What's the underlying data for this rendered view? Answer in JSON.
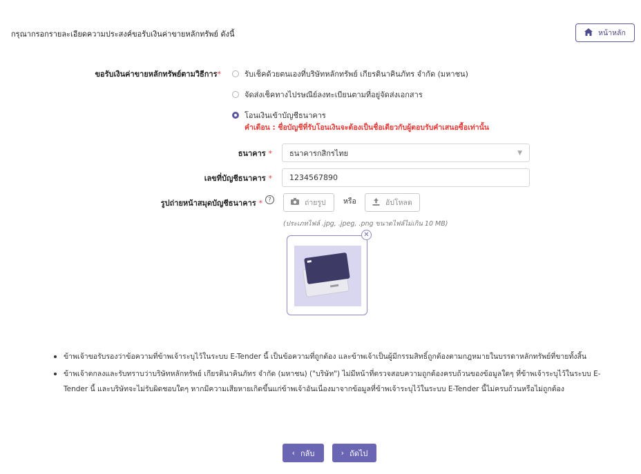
{
  "header": {
    "instruction": "กรุณากรอกรายละเอียดความประสงค์ขอรับเงินค่าขายหลักทรัพย์ ดังนี้",
    "home_label": "หน้าหลัก"
  },
  "form": {
    "method_label": "ขอรับเงินค่าขายหลักทรัพย์ตามวิธีการ",
    "required_mark": "*",
    "options": [
      {
        "label": "รับเช็คด้วยตนเองที่บริษัทหลักทรัพย์ เกียรตินาคินภัทร จำกัด (มหาชน)",
        "checked": false
      },
      {
        "label": "จัดส่งเช็คทางไปรษณีย์ลงทะเบียนตามที่อยู่จัดส่งเอกสาร",
        "checked": false
      },
      {
        "label": "โอนเงินเข้าบัญชีธนาคาร",
        "checked": true
      }
    ],
    "warning": "คำเตือน : ชื่อบัญชีที่รับโอนเงินจะต้องเป็นชื่อเดียวกับผู้ตอบรับคำเสนอซื้อเท่านั้น",
    "bank_label": "ธนาคาร",
    "bank_value": "ธนาคารกสิกรไทย",
    "account_label": "เลขที่บัญชีธนาคาร",
    "account_value": "1234567890",
    "photo_label": "รูปถ่ายหน้าสมุดบัญชีธนาคาร",
    "camera_label": "ถ่ายรูป",
    "or_label": "หรือ",
    "upload_label": "อัปโหลด",
    "file_hint": "(ประเภทไฟล์ .jpg, .jpeg, .png ขนาดไฟล์ไม่เกิน 10 MB)"
  },
  "terms": [
    "ข้าพเจ้าขอรับรองว่าข้อความที่ข้าพเจ้าระบุไว้ในระบบ E-Tender นี้ เป็นข้อความที่ถูกต้อง และข้าพเจ้าเป็นผู้มีกรรมสิทธิ์ถูกต้องตามกฎหมายในบรรดาหลักทรัพย์ที่ขายทั้งสิ้น",
    "ข้าพเจ้าตกลงและรับทราบว่าบริษัทหลักทรัพย์ เกียรตินาคินภัทร จำกัด (มหาชน) (\"บริษัท\") ไม่มีหน้าที่ตรวจสอบความถูกต้องครบถ้วนของข้อมูลใดๆ ที่ข้าพเจ้าระบุไว้ในระบบ E-Tender นี้ และบริษัทจะไม่รับผิดชอบใดๆ หากมีความเสียหายเกิดขึ้นแก่ข้าพเจ้าอันเนื่องมาจากข้อมูลที่ข้าพเจ้าระบุไว้ในระบบ E-Tender นี้ไม่ครบถ้วนหรือไม่ถูกต้อง"
  ],
  "nav": {
    "back_label": "กลับ",
    "next_label": "ถัดไป"
  },
  "colors": {
    "accent": "#6a66b3",
    "warning": "#e53935"
  }
}
